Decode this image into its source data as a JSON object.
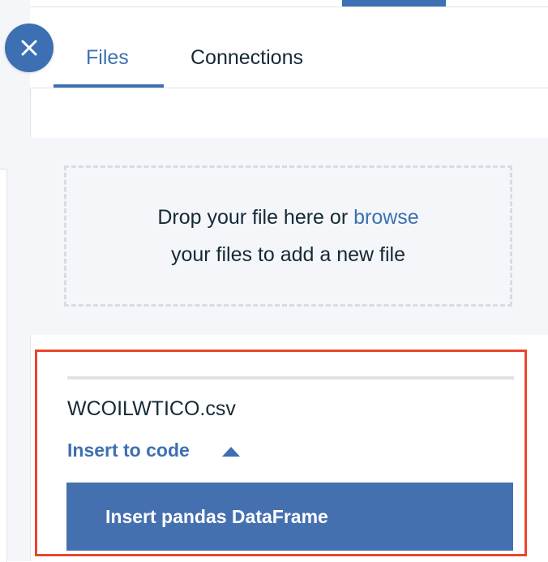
{
  "tabs": {
    "files_label": "Files",
    "connections_label": "Connections"
  },
  "dropzone": {
    "line1_prefix": "Drop your file here or ",
    "browse_link": "browse",
    "line2": "your files to add a new file"
  },
  "file": {
    "name": "WCOILWTICO.csv",
    "insert_label": "Insert to code",
    "insert_option": "Insert pandas DataFrame"
  },
  "icons": {
    "close": "close-icon",
    "caret": "caret-up-icon"
  },
  "colors": {
    "accent": "#3d70b2",
    "highlight_border": "#e8472c",
    "button_bg": "#4570b0"
  }
}
